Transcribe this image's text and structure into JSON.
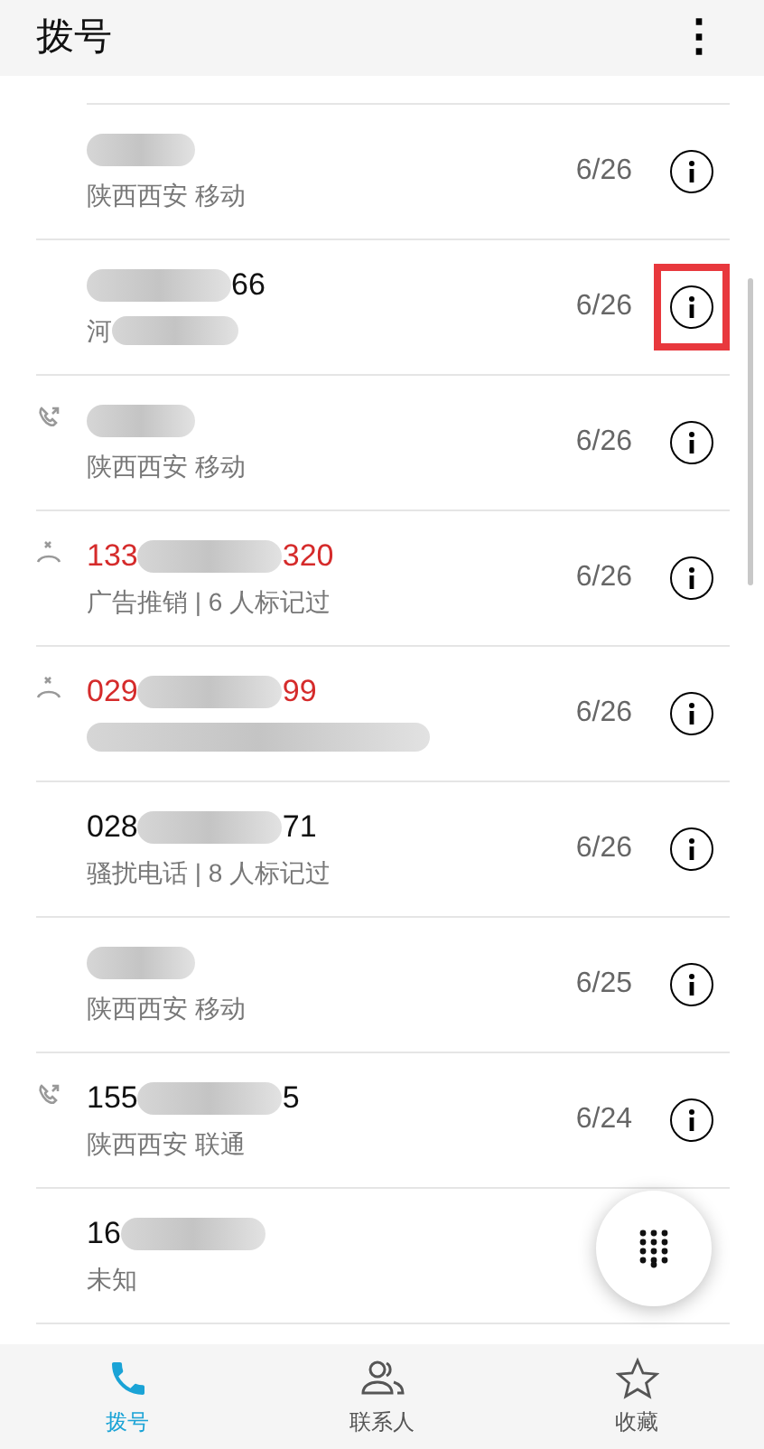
{
  "header": {
    "title": "拨号",
    "menu": "⋮"
  },
  "calls": [
    {
      "kind": "plain",
      "location_start": "陕西西安 移动",
      "location_blurred": false,
      "date": "6/26"
    },
    {
      "kind": "plain",
      "number_end": "66",
      "location_start": "河",
      "location_blurred": true,
      "date": "6/26",
      "highlighted": true
    },
    {
      "kind": "outgoing",
      "location_start": "陕西西安 移动",
      "location_blurred": false,
      "date": "6/26"
    },
    {
      "kind": "missed",
      "number_start": "133",
      "number_end": "320",
      "location_start": "广告推销 | 6 人标记过",
      "location_blurred": false,
      "date": "6/26"
    },
    {
      "kind": "missed",
      "number_start": "029",
      "number_end": "99",
      "location_blurred": true,
      "date": "6/26"
    },
    {
      "kind": "plain",
      "number_start": "028",
      "number_end": "71",
      "location_start": "骚扰电话 | 8 人标记过",
      "location_blurred": false,
      "date": "6/26"
    },
    {
      "kind": "plain",
      "location_start": "陕西西安 移动",
      "location_blurred": false,
      "date": "6/25"
    },
    {
      "kind": "outgoing",
      "number_start": "155",
      "number_end": "5",
      "location_start": "陕西西安 联通",
      "location_blurred": false,
      "date": "6/24"
    },
    {
      "kind": "plain",
      "number_start": "16",
      "location_start": "未知",
      "location_blurred": false
    }
  ],
  "tabs": [
    {
      "kind": "phone",
      "label": "拨号",
      "selected": true
    },
    {
      "kind": "contacts",
      "label": "联系人",
      "selected": false
    },
    {
      "kind": "star",
      "label": "收藏",
      "selected": false
    }
  ]
}
